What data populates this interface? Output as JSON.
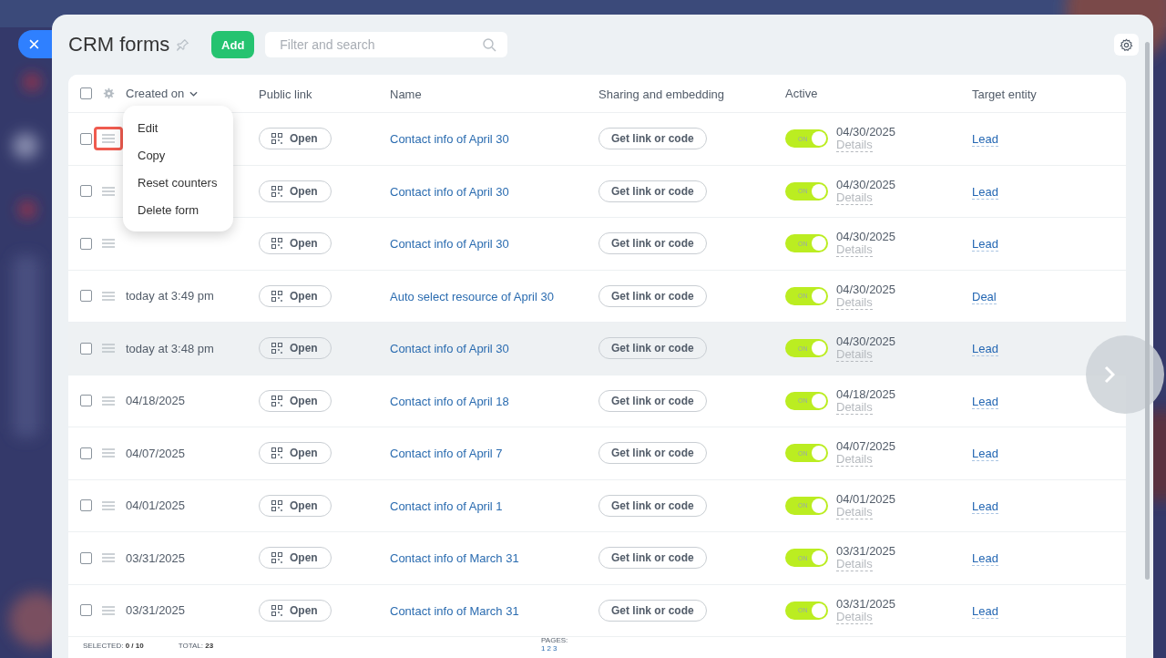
{
  "close_button": {
    "label": "×"
  },
  "header": {
    "title": "CRM forms",
    "add_button": "Add",
    "search": {
      "placeholder": "Filter and search"
    }
  },
  "table": {
    "select_all": {
      "checked": false
    },
    "columns": [
      "Created on",
      "Public link",
      "Name",
      "Sharing and embedding",
      "Active",
      "Target entity"
    ],
    "rows": [
      {
        "link": "Open",
        "name": "Contact info of April 30",
        "share": "Get link or code",
        "active": true,
        "toggle": "ON",
        "date": "04/30/2025",
        "details": "Details",
        "target": "Lead",
        "highlighted": false,
        "menu_open": true
      },
      {
        "link": "Open",
        "name": "Contact info of April 30",
        "share": "Get link or code",
        "active": true,
        "toggle": "ON",
        "date": "04/30/2025",
        "details": "Details",
        "target": "Lead",
        "highlighted": false,
        "menu_open": false
      },
      {
        "link": "Open",
        "name": "Contact info of April 30",
        "share": "Get link or code",
        "active": true,
        "toggle": "ON",
        "date": "04/30/2025",
        "details": "Details",
        "target": "Lead",
        "highlighted": false,
        "menu_open": false
      },
      {
        "created": "today at 3:49 pm",
        "link": "Open",
        "name": "Auto select resource of April 30",
        "share": "Get link or code",
        "active": true,
        "toggle": "ON",
        "date": "04/30/2025",
        "details": "Details",
        "target": "Deal",
        "highlighted": false,
        "menu_open": false
      },
      {
        "created": "today at 3:48 pm",
        "link": "Open",
        "name": "Contact info of April 30",
        "share": "Get link or code",
        "active": true,
        "toggle": "ON",
        "date": "04/30/2025",
        "details": "Details",
        "target": "Lead",
        "highlighted": true,
        "menu_open": false
      },
      {
        "created": "04/18/2025",
        "link": "Open",
        "name": "Contact info of April 18",
        "share": "Get link or code",
        "active": true,
        "toggle": "ON",
        "date": "04/18/2025",
        "details": "Details",
        "target": "Lead",
        "highlighted": false,
        "menu_open": false
      },
      {
        "created": "04/07/2025",
        "link": "Open",
        "name": "Contact info of April 7",
        "share": "Get link or code",
        "active": true,
        "toggle": "ON",
        "date": "04/07/2025",
        "details": "Details",
        "target": "Lead",
        "highlighted": false,
        "menu_open": false
      },
      {
        "created": "04/01/2025",
        "link": "Open",
        "name": "Contact info of April 1",
        "share": "Get link or code",
        "active": true,
        "toggle": "ON",
        "date": "04/01/2025",
        "details": "Details",
        "target": "Lead",
        "highlighted": false,
        "menu_open": false
      },
      {
        "created": "03/31/2025",
        "link": "Open",
        "name": "Contact info of March 31",
        "share": "Get link or code",
        "active": true,
        "toggle": "ON",
        "date": "03/31/2025",
        "details": "Details",
        "target": "Lead",
        "highlighted": false,
        "menu_open": false
      },
      {
        "created": "03/31/2025",
        "link": "Open",
        "name": "Contact info of March 31",
        "share": "Get link or code",
        "active": true,
        "toggle": "ON",
        "date": "03/31/2025",
        "details": "Details",
        "target": "Lead",
        "highlighted": false,
        "menu_open": false
      }
    ]
  },
  "context_menu": [
    "Edit",
    "Copy",
    "Reset counters",
    "Delete form"
  ],
  "footer": {
    "selected_label": "SELECTED:",
    "selected_value": "0 / 10",
    "total_label": "TOTAL:",
    "total_value": "23",
    "pages_label": "PAGES:",
    "pages": [
      "1",
      "2",
      "3"
    ]
  }
}
